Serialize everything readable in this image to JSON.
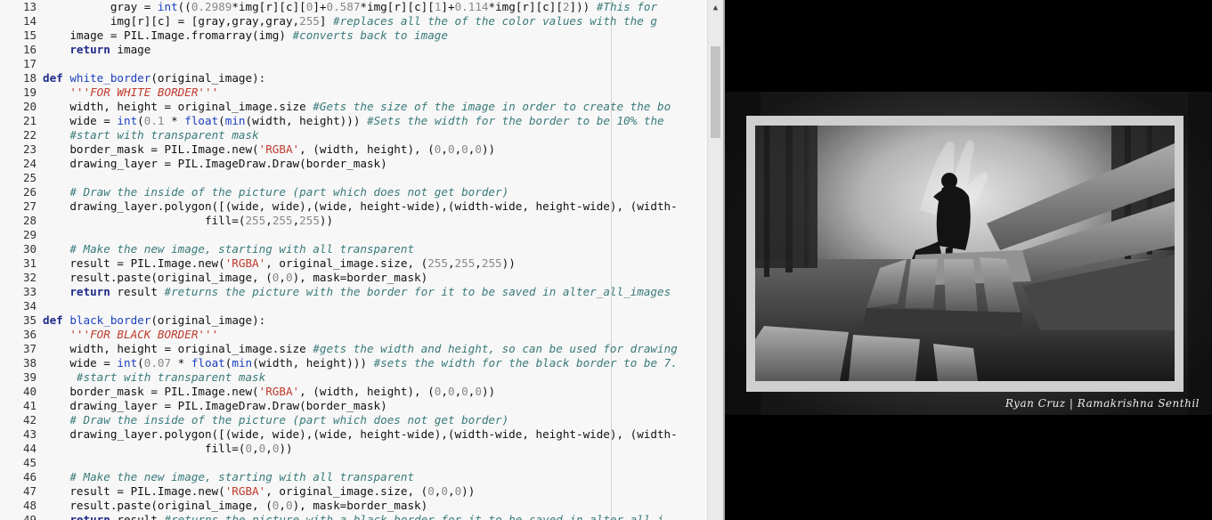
{
  "editor": {
    "line_numbers": [
      "13",
      "14",
      "15",
      "16",
      "17",
      "18",
      "19",
      "20",
      "21",
      "22",
      "23",
      "24",
      "25",
      "26",
      "27",
      "28",
      "29",
      "30",
      "31",
      "32",
      "33",
      "34",
      "35",
      "36",
      "37",
      "38",
      "39",
      "40",
      "41",
      "42",
      "43",
      "44",
      "45",
      "46",
      "47",
      "48",
      "49"
    ]
  },
  "lines": {
    "l13": [
      [
        "",
        "          gray = "
      ],
      [
        "fn",
        "int"
      ],
      [
        "",
        "(("
      ],
      [
        "num",
        "0.2989"
      ],
      [
        "",
        "*img[r][c]["
      ],
      [
        "num",
        "0"
      ],
      [
        "",
        "]+"
      ],
      [
        "num",
        "0.587"
      ],
      [
        "",
        "*img[r][c]["
      ],
      [
        "num",
        "1"
      ],
      [
        "",
        "]+"
      ],
      [
        "num",
        "0.114"
      ],
      [
        "",
        "*img[r][c]["
      ],
      [
        "num",
        "2"
      ],
      [
        "",
        "]))"
      ],
      [
        "cm",
        " #This for"
      ]
    ],
    "l14": [
      [
        "",
        "          img[r][c] = [gray,gray,gray,"
      ],
      [
        "num",
        "255"
      ],
      [
        "",
        "] "
      ],
      [
        "cm",
        "#replaces all the of the color values with the g"
      ]
    ],
    "l15": [
      [
        "",
        "    image = PIL.Image.fromarray(img) "
      ],
      [
        "cm",
        "#converts back to image"
      ]
    ],
    "l16": [
      [
        "",
        "    "
      ],
      [
        "kw",
        "return"
      ],
      [
        "",
        " image"
      ]
    ],
    "l17": [
      [
        "",
        ""
      ]
    ],
    "l18": [
      [
        "kw",
        "def"
      ],
      [
        "",
        " "
      ],
      [
        "fn",
        "white_border"
      ],
      [
        "",
        "(original_image):"
      ]
    ],
    "l19": [
      [
        "",
        "    "
      ],
      [
        "doc",
        "'''FOR WHITE BORDER'''"
      ]
    ],
    "l20": [
      [
        "",
        "    width, height = original_image.size "
      ],
      [
        "cm",
        "#Gets the size of the image in order to create the bo"
      ]
    ],
    "l21": [
      [
        "",
        "    wide = "
      ],
      [
        "fn",
        "int"
      ],
      [
        "",
        "("
      ],
      [
        "num",
        "0.1"
      ],
      [
        "",
        " * "
      ],
      [
        "fn",
        "float"
      ],
      [
        "",
        "("
      ],
      [
        "fn",
        "min"
      ],
      [
        "",
        "(width, height))) "
      ],
      [
        "cm",
        "#Sets the width for the border to be 10% the"
      ]
    ],
    "l22": [
      [
        "",
        "    "
      ],
      [
        "cm",
        "#start with transparent mask"
      ]
    ],
    "l23": [
      [
        "",
        "    border_mask = PIL.Image.new("
      ],
      [
        "str",
        "'RGBA'"
      ],
      [
        "",
        ", (width, height), ("
      ],
      [
        "num",
        "0"
      ],
      [
        "",
        ","
      ],
      [
        "num",
        "0"
      ],
      [
        "",
        ","
      ],
      [
        "num",
        "0"
      ],
      [
        "",
        ","
      ],
      [
        "num",
        "0"
      ],
      [
        "",
        "))"
      ]
    ],
    "l24": [
      [
        "",
        "    drawing_layer = PIL.ImageDraw.Draw(border_mask)"
      ]
    ],
    "l25": [
      [
        "",
        ""
      ]
    ],
    "l26": [
      [
        "",
        "    "
      ],
      [
        "cm",
        "# Draw the inside of the picture (part which does not get border)"
      ]
    ],
    "l27": [
      [
        "",
        "    drawing_layer.polygon([(wide, wide),(wide, height-wide),(width-wide, height-wide), (width-"
      ]
    ],
    "l28": [
      [
        "",
        "                        fill=("
      ],
      [
        "num",
        "255"
      ],
      [
        "",
        ","
      ],
      [
        "num",
        "255"
      ],
      [
        "",
        ","
      ],
      [
        "num",
        "255"
      ],
      [
        "",
        "))"
      ]
    ],
    "l29": [
      [
        "",
        ""
      ]
    ],
    "l30": [
      [
        "",
        "    "
      ],
      [
        "cm",
        "# Make the new image, starting with all transparent"
      ]
    ],
    "l31": [
      [
        "",
        "    result = PIL.Image.new("
      ],
      [
        "str",
        "'RGBA'"
      ],
      [
        "",
        ", original_image.size, ("
      ],
      [
        "num",
        "255"
      ],
      [
        "",
        ","
      ],
      [
        "num",
        "255"
      ],
      [
        "",
        ","
      ],
      [
        "num",
        "255"
      ],
      [
        "",
        "))"
      ]
    ],
    "l32": [
      [
        "",
        "    result.paste(original_image, ("
      ],
      [
        "num",
        "0"
      ],
      [
        "",
        ","
      ],
      [
        "num",
        "0"
      ],
      [
        "",
        "), mask=border_mask)"
      ]
    ],
    "l33": [
      [
        "",
        "    "
      ],
      [
        "kw",
        "return"
      ],
      [
        "",
        " result "
      ],
      [
        "cm",
        "#returns the picture with the border for it to be saved in alter_all_images"
      ]
    ],
    "l34": [
      [
        "",
        ""
      ]
    ],
    "l35": [
      [
        "kw",
        "def"
      ],
      [
        "",
        " "
      ],
      [
        "fn",
        "black_border"
      ],
      [
        "",
        "(original_image):"
      ]
    ],
    "l36": [
      [
        "",
        "    "
      ],
      [
        "doc",
        "'''FOR BLACK BORDER'''"
      ]
    ],
    "l37": [
      [
        "",
        "    width, height = original_image.size "
      ],
      [
        "cm",
        "#gets the width and height, so can be used for drawing"
      ]
    ],
    "l38": [
      [
        "",
        "    wide = "
      ],
      [
        "fn",
        "int"
      ],
      [
        "",
        "("
      ],
      [
        "num",
        "0.07"
      ],
      [
        "",
        " * "
      ],
      [
        "fn",
        "float"
      ],
      [
        "",
        "("
      ],
      [
        "fn",
        "min"
      ],
      [
        "",
        "(width, height))) "
      ],
      [
        "cm",
        "#sets the width for the black border to be 7."
      ]
    ],
    "l39": [
      [
        "",
        "     "
      ],
      [
        "cm",
        "#start with transparent mask"
      ]
    ],
    "l40": [
      [
        "",
        "    border_mask = PIL.Image.new("
      ],
      [
        "str",
        "'RGBA'"
      ],
      [
        "",
        ", (width, height), ("
      ],
      [
        "num",
        "0"
      ],
      [
        "",
        ","
      ],
      [
        "num",
        "0"
      ],
      [
        "",
        ","
      ],
      [
        "num",
        "0"
      ],
      [
        "",
        ","
      ],
      [
        "num",
        "0"
      ],
      [
        "",
        "))"
      ]
    ],
    "l41": [
      [
        "",
        "    drawing_layer = PIL.ImageDraw.Draw(border_mask)"
      ]
    ],
    "l42": [
      [
        "",
        "    "
      ],
      [
        "cm",
        "# Draw the inside of the picture (part which does not get border)"
      ]
    ],
    "l43": [
      [
        "",
        "    drawing_layer.polygon([(wide, wide),(wide, height-wide),(width-wide, height-wide), (width-"
      ]
    ],
    "l44": [
      [
        "",
        "                        fill=("
      ],
      [
        "num",
        "0"
      ],
      [
        "",
        ","
      ],
      [
        "num",
        "0"
      ],
      [
        "",
        ","
      ],
      [
        "num",
        "0"
      ],
      [
        "",
        "))"
      ]
    ],
    "l45": [
      [
        "",
        ""
      ]
    ],
    "l46": [
      [
        "",
        "    "
      ],
      [
        "cm",
        "# Make the new image, starting with all transparent"
      ]
    ],
    "l47": [
      [
        "",
        "    result = PIL.Image.new("
      ],
      [
        "str",
        "'RGBA'"
      ],
      [
        "",
        ", original_image.size, ("
      ],
      [
        "num",
        "0"
      ],
      [
        "",
        ","
      ],
      [
        "num",
        "0"
      ],
      [
        "",
        ","
      ],
      [
        "num",
        "0"
      ],
      [
        "",
        "))"
      ]
    ],
    "l48": [
      [
        "",
        "    result.paste(original_image, ("
      ],
      [
        "num",
        "0"
      ],
      [
        "",
        ","
      ],
      [
        "num",
        "0"
      ],
      [
        "",
        "), mask=border_mask)"
      ]
    ],
    "l49": [
      [
        "",
        "    "
      ],
      [
        "kw",
        "return"
      ],
      [
        "",
        " result "
      ],
      [
        "cm",
        "#returns the picture with a black border for it to be saved in alter_all_i"
      ]
    ]
  },
  "image_viewer": {
    "credit": "Ryan Cruz | Ramakrishna Senthil"
  },
  "icons": {
    "scroll_up": "chevron-up-icon"
  },
  "colors": {
    "editor_bg": "#f7f7f7",
    "keyword": "#1f2a8a",
    "comment": "#3a7a7a",
    "string": "#c0392b",
    "number": "#888888",
    "viewer_bg": "#000000"
  }
}
